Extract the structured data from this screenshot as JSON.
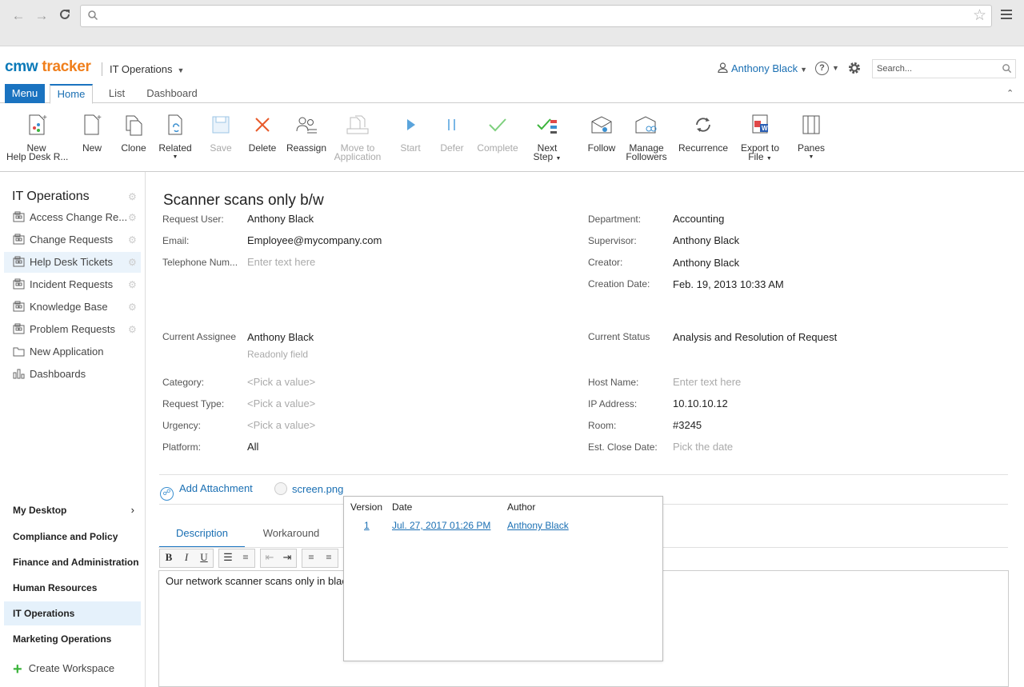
{
  "browser": {
    "address_value": ""
  },
  "app": {
    "logo_part1": "cmw",
    "logo_part2": " tracker",
    "workspace": "IT Operations",
    "user": "Anthony Black",
    "search_placeholder": "Search..."
  },
  "tabs": {
    "menu": "Menu",
    "home": "Home",
    "list": "List",
    "dashboard": "Dashboard"
  },
  "toolbar": {
    "new_hd_line1": "New",
    "new_hd_line2": "Help Desk R...",
    "new": "New",
    "clone": "Clone",
    "related": "Related",
    "save": "Save",
    "delete": "Delete",
    "reassign": "Reassign",
    "move_line1": "Move to",
    "move_line2": "Application",
    "start": "Start",
    "defer": "Defer",
    "complete": "Complete",
    "next_line1": "Next",
    "next_line2": "Step",
    "follow": "Follow",
    "manage_line1": "Manage",
    "manage_line2": "Followers",
    "recurrence": "Recurrence",
    "export_line1": "Export to",
    "export_line2": "File",
    "panes": "Panes"
  },
  "sidebar": {
    "title": "IT Operations",
    "items": [
      {
        "label": "Access Change Re..."
      },
      {
        "label": "Change Requests"
      },
      {
        "label": "Help Desk Tickets"
      },
      {
        "label": "Incident Requests"
      },
      {
        "label": "Knowledge Base"
      },
      {
        "label": "Problem Requests"
      },
      {
        "label": "New Application"
      },
      {
        "label": "Dashboards"
      }
    ],
    "workspaces": [
      {
        "label": "My Desktop"
      },
      {
        "label": "Compliance and Policy"
      },
      {
        "label": "Finance and Administration"
      },
      {
        "label": "Human Resources"
      },
      {
        "label": "IT Operations"
      },
      {
        "label": "Marketing Operations"
      }
    ],
    "create_workspace": "Create Workspace"
  },
  "form": {
    "title": "Scanner scans only b/w",
    "request_user_label": "Request User:",
    "request_user": "Anthony Black",
    "email_label": "Email:",
    "email": "Employee@mycompany.com",
    "phone_label": "Telephone Num...",
    "phone_placeholder": "Enter text here",
    "department_label": "Department:",
    "department": "Accounting",
    "supervisor_label": "Supervisor:",
    "supervisor": "Anthony Black",
    "creator_label": "Creator:",
    "creator": "Anthony Black",
    "creation_date_label": "Creation Date:",
    "creation_date": "Feb. 19, 2013 10:33 AM",
    "assignee_label": "Current Assignee",
    "assignee": "Anthony Black",
    "assignee_note": "Readonly field",
    "status_label": "Current Status",
    "status": "Analysis and Resolution of Request",
    "category_label": "Category:",
    "category": "<Pick a value>",
    "request_type_label": "Request Type:",
    "request_type": "<Pick a value>",
    "urgency_label": "Urgency:",
    "urgency": "<Pick a value>",
    "platform_label": "Platform:",
    "platform": "All",
    "host_label": "Host Name:",
    "host_placeholder": "Enter text here",
    "ip_label": "IP Address:",
    "ip": "10.10.10.12",
    "room_label": "Room:",
    "room": "#3245",
    "close_date_label": "Est. Close Date:",
    "close_date_placeholder": "Pick the date",
    "add_attachment": "Add Attachment",
    "file_name": "screen.png",
    "tab_description": "Description",
    "tab_workaround": "Workaround",
    "description_text": "Our network scanner scans only in black"
  },
  "popup": {
    "col_version": "Version",
    "col_date": "Date",
    "col_author": "Author",
    "version": "1",
    "date": "Jul. 27, 2017 01:26 PM",
    "author": "Anthony Black"
  }
}
